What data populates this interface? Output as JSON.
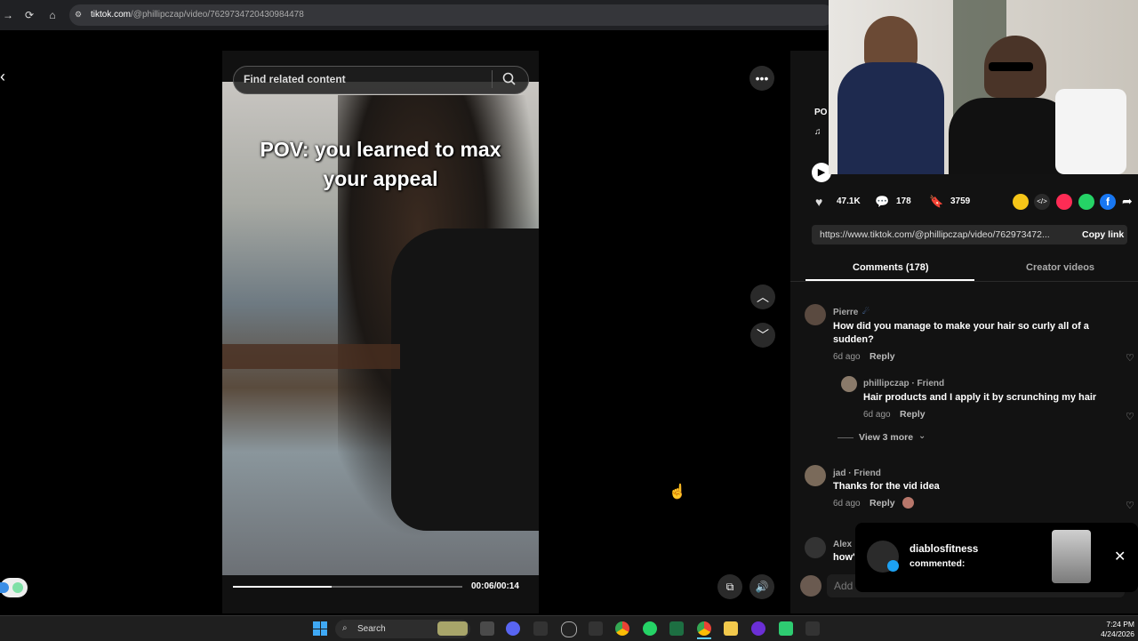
{
  "browser": {
    "url_domain": "tiktok.com",
    "url_path": "/@phillipczap/video/7629734720430984478"
  },
  "video": {
    "search_placeholder": "Find related content",
    "overlay_text_line1": "POV: you learned to max",
    "overlay_text_line2": "your appeal",
    "time_current": "00:06",
    "time_total": "00:14",
    "time_display": "00:06/00:14",
    "progress_fraction": 0.43
  },
  "right_panel": {
    "caption_partial": "PO",
    "stats": {
      "likes": "47.1K",
      "comments": "178",
      "saves": "3759"
    },
    "share_link": "https://www.tiktok.com/@phillipczap/video/762973472...",
    "copy_link_label": "Copy link",
    "tabs": {
      "comments": "Comments (178)",
      "creator_videos": "Creator videos"
    },
    "comments": [
      {
        "user": "Pierre",
        "text_line1": "How did you manage to make your hair so curly all of a",
        "text_line2": "sudden?",
        "time": "6d ago",
        "reply": "Reply"
      },
      {
        "user": "phillipczap · Friend",
        "text": "Hair products and I apply it by scrunching my hair",
        "time": "6d ago",
        "reply": "Reply"
      },
      {
        "view_more": "View 3 more"
      },
      {
        "user": "jad · Friend",
        "text": "Thanks for the vid idea",
        "time": "6d ago",
        "reply": "Reply"
      },
      {
        "user": "Alex",
        "text": "how'"
      }
    ],
    "comment_input_placeholder": "Add"
  },
  "notification": {
    "user": "diablosfitness",
    "action": "commented:"
  },
  "taskbar": {
    "search_label": "Search",
    "time": "7:24 PM",
    "date": "4/24/2026"
  },
  "colors": {
    "background": "#000000",
    "panel": "#121212",
    "accent_red": "#fe2c55",
    "whatsapp": "#25d366",
    "facebook": "#1877f2"
  }
}
